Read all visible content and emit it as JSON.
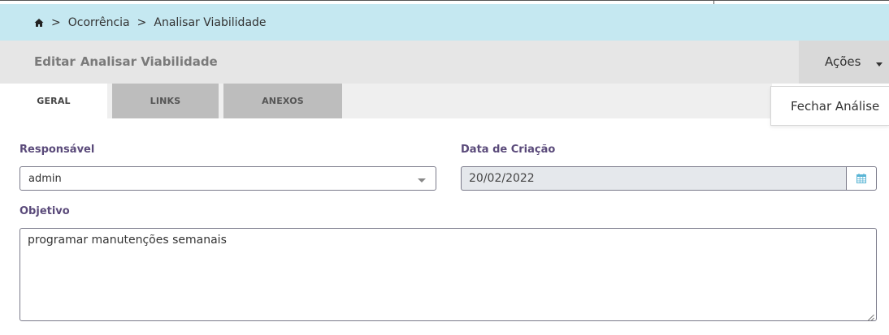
{
  "breadcrumb": {
    "home_icon": "home-icon",
    "separator": ">",
    "items": [
      "Ocorrência",
      "Analisar Viabilidade"
    ]
  },
  "header": {
    "prefix": "Editar",
    "title": "Analisar Viabilidade",
    "actions_label": "Ações"
  },
  "tabs": [
    {
      "label": "GERAL",
      "active": true
    },
    {
      "label": "LINKS",
      "active": false
    },
    {
      "label": "ANEXOS",
      "active": false
    }
  ],
  "actions_menu": {
    "items": [
      "Fechar Análise"
    ]
  },
  "form": {
    "responsavel": {
      "label": "Responsável",
      "value": "admin"
    },
    "data_criacao": {
      "label": "Data de Criação",
      "value": "20/02/2022",
      "icon": "calendar-icon"
    },
    "objetivo": {
      "label": "Objetivo",
      "value": "programar manutenções semanais"
    }
  },
  "colors": {
    "breadcrumb_bg": "#c5e8f1",
    "header_bg": "#e6e6e6",
    "label_color": "#5a4a7a",
    "calendar_icon": "#5bb5d5"
  }
}
